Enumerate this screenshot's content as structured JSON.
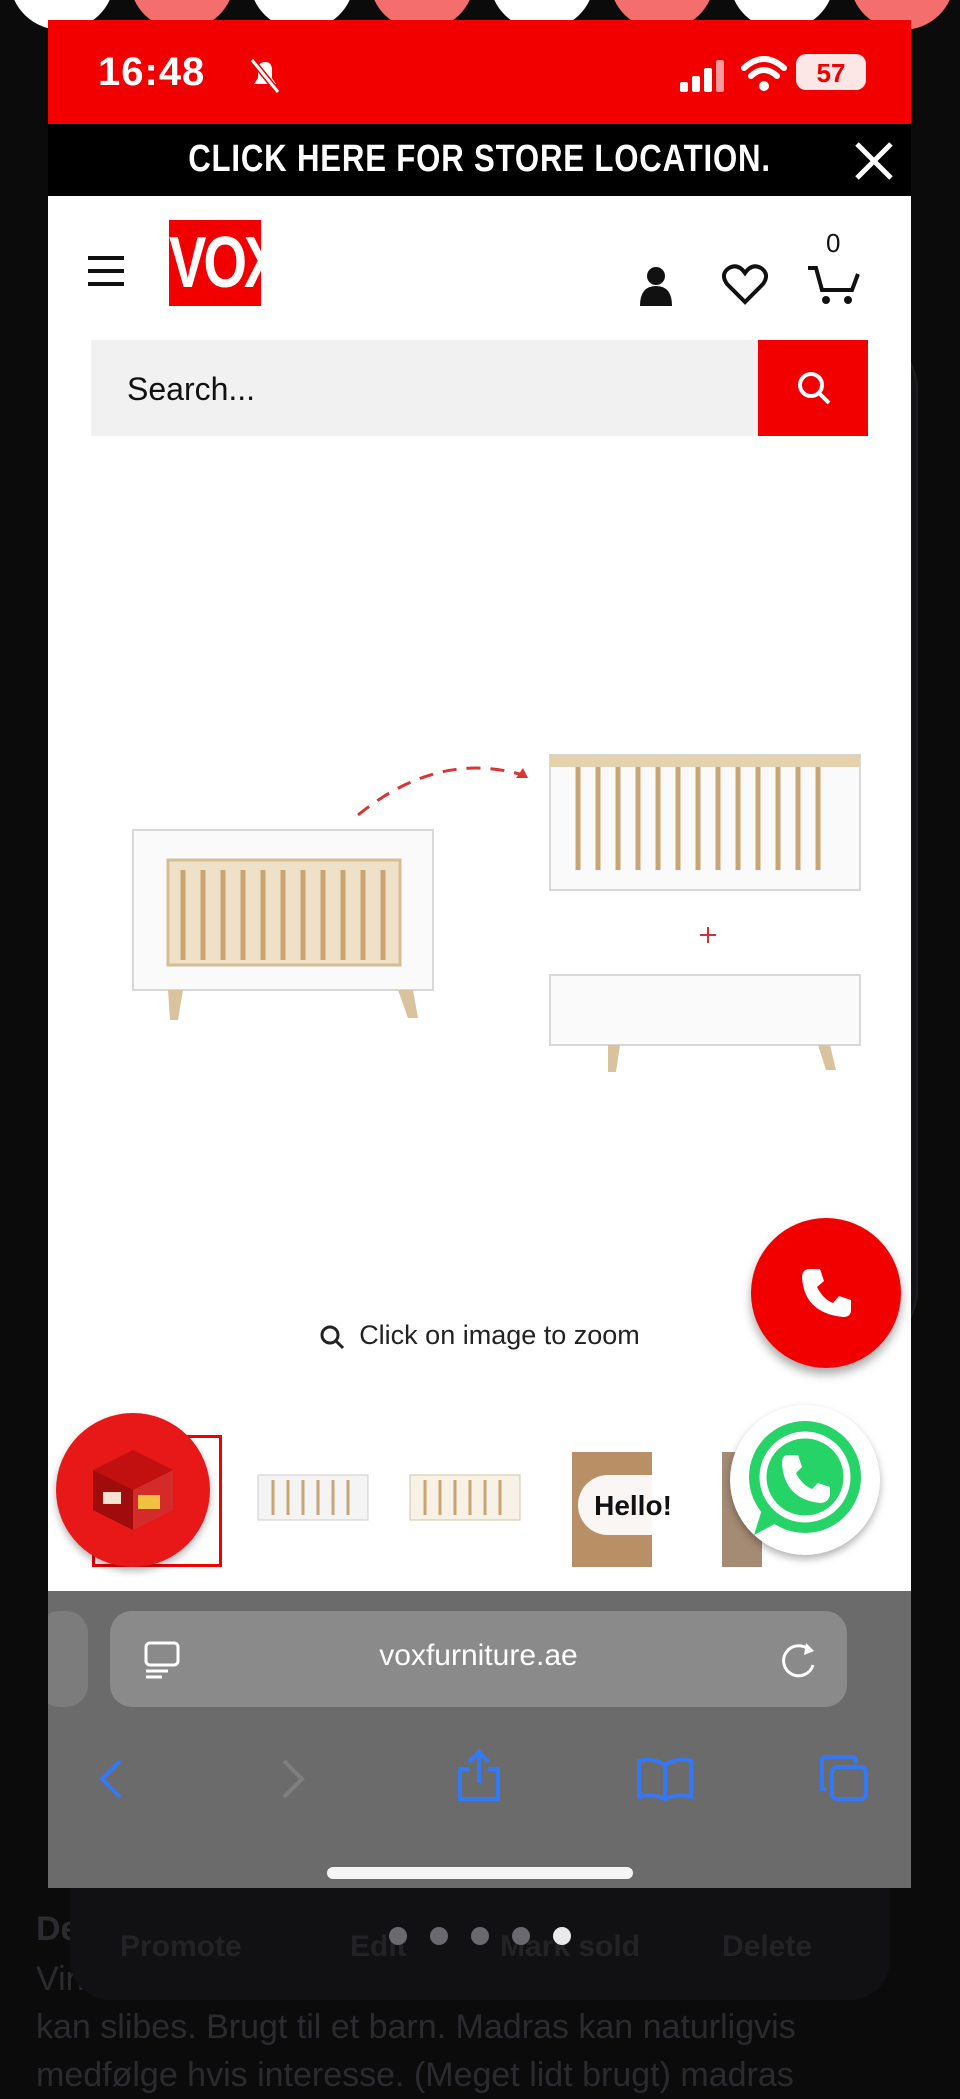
{
  "status_bar": {
    "time": "16:48",
    "battery": "57"
  },
  "promo_banner": {
    "text": "CLICK HERE FOR STORE LOCATION."
  },
  "header": {
    "logo": "VOX",
    "cart_count": "0"
  },
  "search": {
    "placeholder": "Search..."
  },
  "product": {
    "zoom_hint": "Click on image to zoom"
  },
  "chat": {
    "bubble_text": "Hello!"
  },
  "browser": {
    "url": "voxfurniture.ae"
  },
  "background_app": {
    "description_heading": "De",
    "description_lines": [
      "Virkelig",
      "kan slibes. Brugt til et barn. Madras kan naturligvis",
      "medfølge hvis interesse. (Meget lidt brugt) madras"
    ],
    "actions": [
      "Promote",
      "Edit",
      "Mark sold",
      "Delete"
    ]
  },
  "colors": {
    "brand_red": "#f20000",
    "browser_gray": "#6b6b6b",
    "whatsapp_green": "#25d366",
    "icon_blue": "#3478f6"
  },
  "icons": [
    "menu-icon",
    "account-icon",
    "heart-icon",
    "cart-icon",
    "search-icon",
    "phone-icon",
    "whatsapp-icon",
    "close-icon",
    "back-icon",
    "forward-icon",
    "share-icon",
    "bookmarks-icon",
    "tabs-icon",
    "reload-icon",
    "reader-icon"
  ]
}
